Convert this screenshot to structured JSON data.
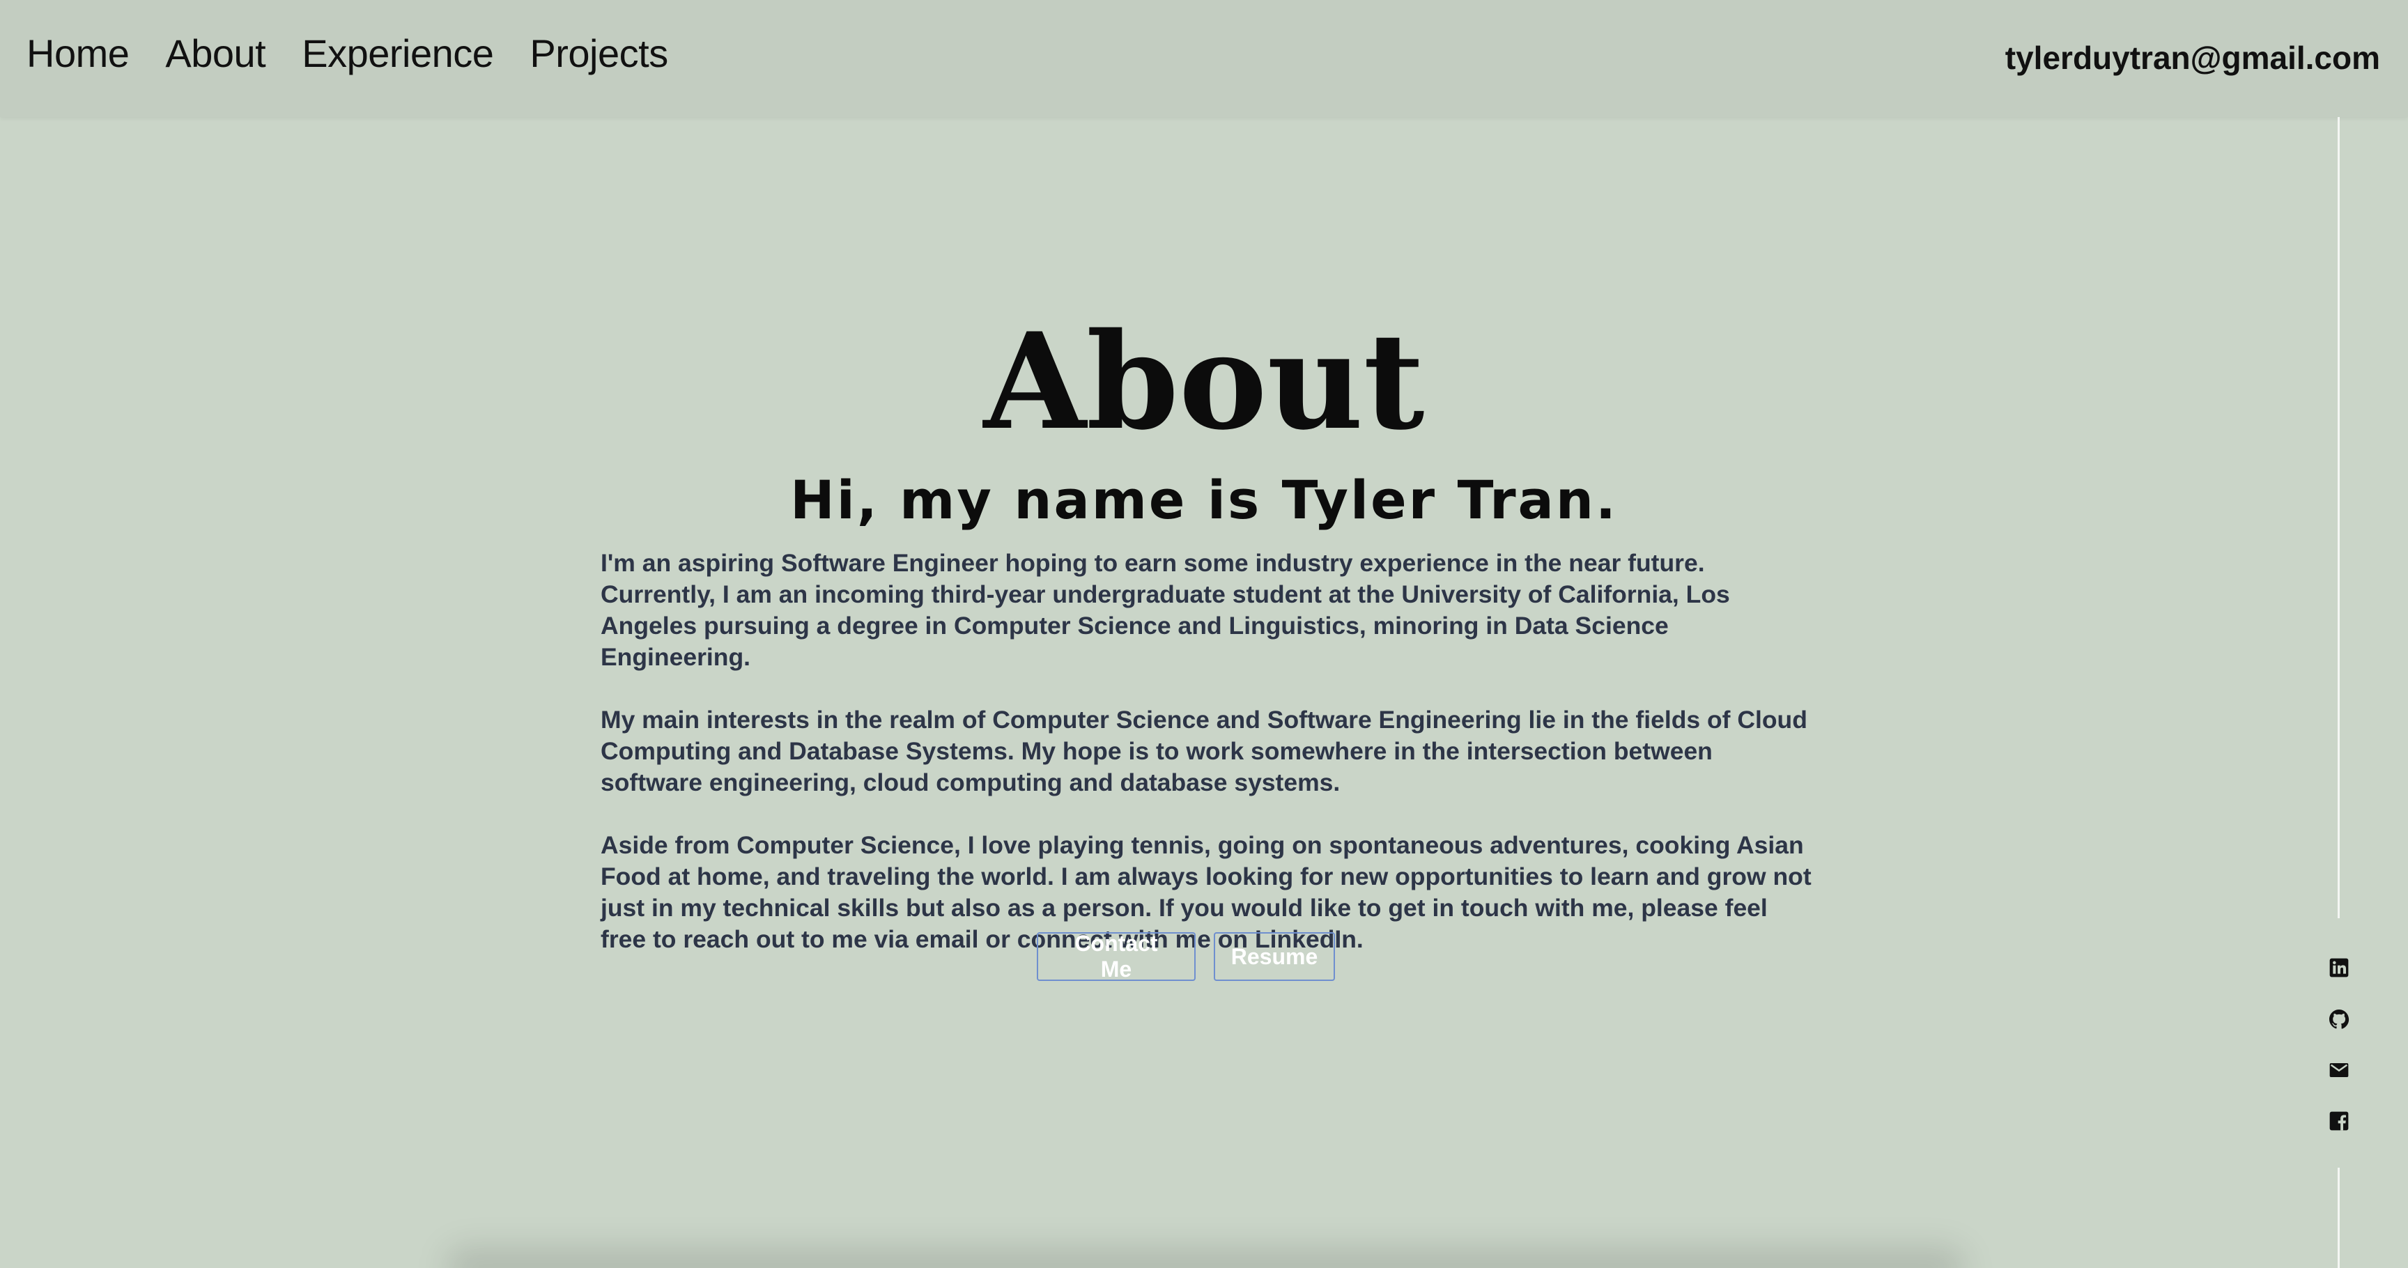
{
  "nav": {
    "links": [
      "Home",
      "About",
      "Experience",
      "Projects"
    ],
    "email": "tylerduytran@gmail.com"
  },
  "about": {
    "title": "About",
    "greeting": "Hi, my name is Tyler Tran.",
    "paragraphs": [
      "I'm an aspiring Software Engineer hoping to earn some industry experience in the near future. Currently, I am an incoming third-year undergraduate student at the University of California, Los Angeles pursuing a degree in Computer Science and Linguistics, minoring in Data Science Engineering.",
      "My main interests in the realm of Computer Science and Software Engineering lie in the fields of Cloud Computing and Database Systems. My hope is to work somewhere in the intersection between software engineering, cloud computing and database systems.",
      "Aside from Computer Science, I love playing tennis, going on spontaneous adventures, cooking Asian Food at home, and traveling the world. I am always looking for new opportunities to learn and grow not just in my technical skills but also as a person. If you would like to get in touch with me, please feel free to reach out to me via email or connect with me on LinkedIn."
    ],
    "buttons": {
      "contact": "Contact Me",
      "resume": "Resume"
    }
  },
  "social": [
    "linkedin-icon",
    "github-icon",
    "mail-icon",
    "facebook-icon"
  ],
  "colors": {
    "background": "#cad5c8",
    "nav_background": "#c3cdc1",
    "body_text": "#2d3547",
    "button_border": "#6f8fcf"
  }
}
